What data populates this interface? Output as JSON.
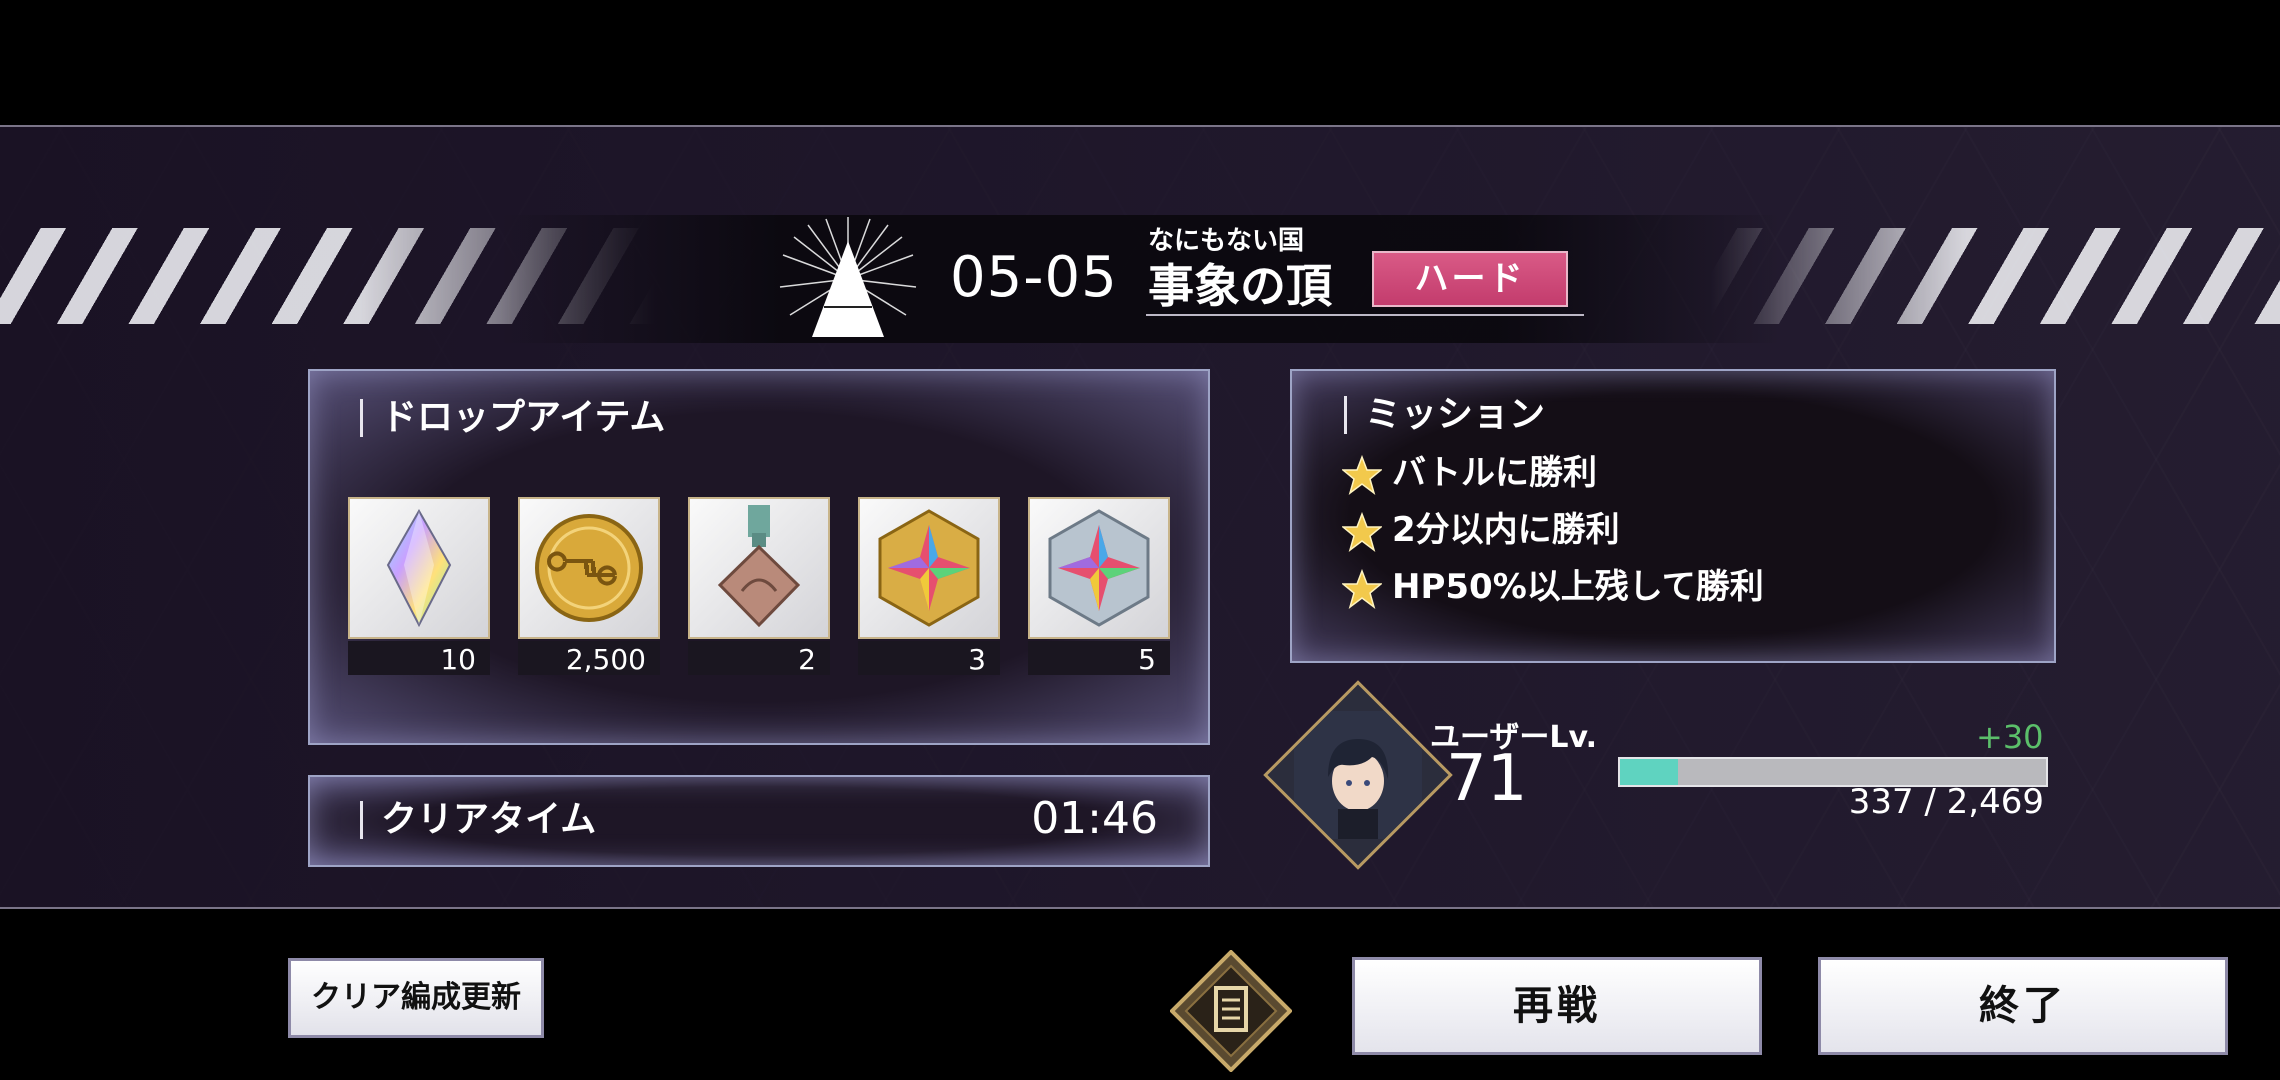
{
  "stage": {
    "number": "05-05",
    "subtitle": "なにもない国",
    "name": "事象の頂",
    "difficulty": "ハード"
  },
  "drops": {
    "title": "ドロップアイテム",
    "items": [
      {
        "icon": "rainbow-crystal-icon",
        "count": "10"
      },
      {
        "icon": "gold-coin-icon",
        "count": "2,500"
      },
      {
        "icon": "bronze-medal-icon",
        "count": "2"
      },
      {
        "icon": "gold-star-emblem-icon",
        "count": "3"
      },
      {
        "icon": "silver-star-emblem-icon",
        "count": "5"
      }
    ]
  },
  "clear_time": {
    "label": "クリアタイム",
    "value": "01:46"
  },
  "missions": {
    "title": "ミッション",
    "items": [
      "バトルに勝利",
      "2分以内に勝利",
      "HP50%以上残して勝利"
    ]
  },
  "user": {
    "level_label": "ユーザーLv.",
    "level": "71",
    "exp_gain": "+30",
    "exp_text": "337 / 2,469",
    "exp_fraction": 0.137
  },
  "buttons": {
    "update_party": "クリア編成更新",
    "retry": "再戦",
    "finish": "終了"
  },
  "colors": {
    "difficulty": "#c33c6d",
    "exp_fill": "#5fd3c0",
    "exp_gain": "#5bbf6a",
    "star": "#f2c94c"
  }
}
